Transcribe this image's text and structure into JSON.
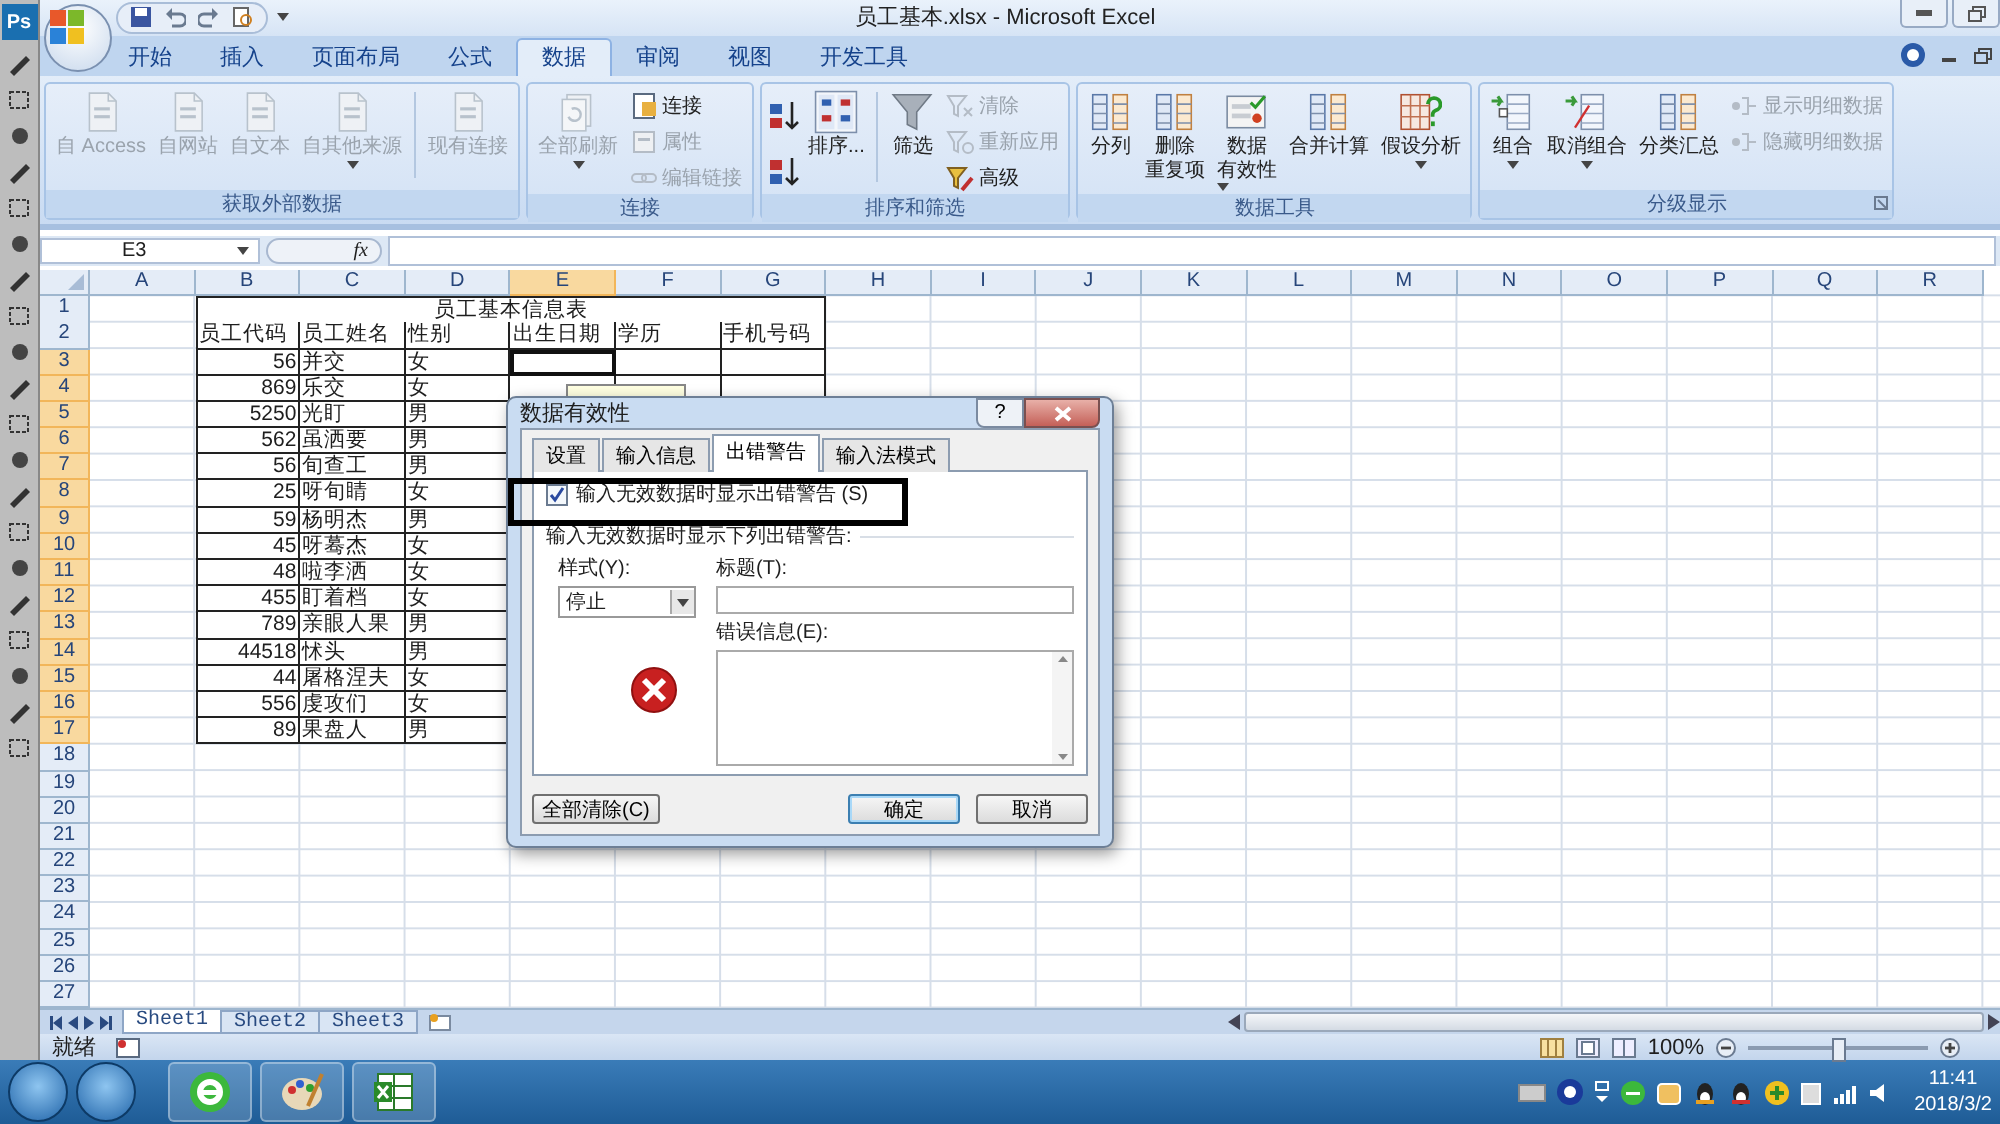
{
  "ps_label": "Ps",
  "window": {
    "title": "员工基本.xlsx - Microsoft Excel"
  },
  "ribbon_tabs": [
    {
      "label": "开始",
      "selected": false
    },
    {
      "label": "插入",
      "selected": false
    },
    {
      "label": "页面布局",
      "selected": false
    },
    {
      "label": "公式",
      "selected": false
    },
    {
      "label": "数据",
      "selected": true
    },
    {
      "label": "审阅",
      "selected": false
    },
    {
      "label": "视图",
      "selected": false
    },
    {
      "label": "开发工具",
      "selected": false
    }
  ],
  "ribbon_groups": [
    {
      "title": "获取外部数据",
      "launcher": false,
      "items": [
        {
          "kind": "large",
          "lines": [
            "自 Access"
          ],
          "disabled": true,
          "dropdown": false
        },
        {
          "kind": "large",
          "lines": [
            "自网站"
          ],
          "disabled": true,
          "dropdown": false
        },
        {
          "kind": "large",
          "lines": [
            "自文本"
          ],
          "disabled": true,
          "dropdown": false
        },
        {
          "kind": "large",
          "lines": [
            "自其他来源"
          ],
          "disabled": true,
          "dropdown": true
        },
        {
          "kind": "separator"
        },
        {
          "kind": "large",
          "lines": [
            "现有连接"
          ],
          "disabled": true,
          "dropdown": false
        }
      ]
    },
    {
      "title": "连接",
      "launcher": false,
      "items": [
        {
          "kind": "large",
          "lines": [
            "全部刷新"
          ],
          "disabled": true,
          "dropdown": true
        },
        {
          "kind": "stack",
          "items": [
            {
              "label": "连接",
              "disabled": false
            },
            {
              "label": "属性",
              "disabled": true
            },
            {
              "label": "编辑链接",
              "disabled": true
            }
          ]
        }
      ]
    },
    {
      "title": "排序和筛选",
      "launcher": false,
      "items": [
        {
          "kind": "sort_pair"
        },
        {
          "kind": "large",
          "lines": [
            "排序..."
          ],
          "disabled": false,
          "dropdown": false
        },
        {
          "kind": "separator"
        },
        {
          "kind": "large",
          "lines": [
            "筛选"
          ],
          "disabled": false,
          "dropdown": false
        },
        {
          "kind": "stack",
          "items": [
            {
              "label": "清除",
              "disabled": true
            },
            {
              "label": "重新应用",
              "disabled": true
            },
            {
              "label": "高级",
              "disabled": false
            }
          ]
        }
      ]
    },
    {
      "title": "数据工具",
      "launcher": false,
      "items": [
        {
          "kind": "large",
          "lines": [
            "分列"
          ],
          "disabled": false,
          "dropdown": false
        },
        {
          "kind": "large",
          "lines": [
            "删除",
            "重复项"
          ],
          "disabled": false,
          "dropdown": false
        },
        {
          "kind": "large",
          "lines": [
            "数据",
            "有效性"
          ],
          "disabled": false,
          "dropdown": true
        },
        {
          "kind": "large",
          "lines": [
            "合并计算"
          ],
          "disabled": false,
          "dropdown": false
        },
        {
          "kind": "large",
          "lines": [
            "假设分析"
          ],
          "disabled": false,
          "dropdown": true
        }
      ]
    },
    {
      "title": "分级显示",
      "launcher": true,
      "items": [
        {
          "kind": "large",
          "lines": [
            "组合"
          ],
          "disabled": false,
          "dropdown": true
        },
        {
          "kind": "large",
          "lines": [
            "取消组合"
          ],
          "disabled": false,
          "dropdown": true
        },
        {
          "kind": "large",
          "lines": [
            "分类汇总"
          ],
          "disabled": false,
          "dropdown": false
        },
        {
          "kind": "stack",
          "items": [
            {
              "label": "显示明细数据",
              "disabled": true
            },
            {
              "label": "隐藏明细数据",
              "disabled": true
            }
          ]
        }
      ]
    }
  ],
  "formula_bar": {
    "name_box": "E3",
    "fx": "fx"
  },
  "columns": [
    {
      "label": "A",
      "selected": false
    },
    {
      "label": "B",
      "selected": false
    },
    {
      "label": "C",
      "selected": false
    },
    {
      "label": "D",
      "selected": false
    },
    {
      "label": "E",
      "selected": true
    },
    {
      "label": "F",
      "selected": false
    },
    {
      "label": "G",
      "selected": false
    },
    {
      "label": "H",
      "selected": false
    },
    {
      "label": "I",
      "selected": false
    },
    {
      "label": "J",
      "selected": false
    },
    {
      "label": "K",
      "selected": false
    },
    {
      "label": "L",
      "selected": false
    },
    {
      "label": "M",
      "selected": false
    },
    {
      "label": "N",
      "selected": false
    },
    {
      "label": "O",
      "selected": false
    },
    {
      "label": "P",
      "selected": false
    },
    {
      "label": "Q",
      "selected": false
    },
    {
      "label": "R",
      "selected": false
    }
  ],
  "rows": [
    {
      "label": "1",
      "selected": false,
      "kind": "title",
      "text": "员工基本信息表"
    },
    {
      "label": "2",
      "selected": false,
      "kind": "header",
      "cells": [
        "员工代码",
        "员工姓名",
        "性别",
        "出生日期",
        "学历",
        "手机号码"
      ]
    },
    {
      "label": "3",
      "selected": true,
      "kind": "record",
      "active_cell": true,
      "code": "56",
      "name": "并交",
      "gender": "女"
    },
    {
      "label": "4",
      "selected": true,
      "kind": "record",
      "code": "869",
      "name": "乐交",
      "gender": "女"
    },
    {
      "label": "5",
      "selected": true,
      "kind": "record",
      "code": "5250",
      "name": "光盯",
      "gender": "男"
    },
    {
      "label": "6",
      "selected": true,
      "kind": "record",
      "code": "562",
      "name": "虽洒要",
      "gender": "男"
    },
    {
      "label": "7",
      "selected": true,
      "kind": "record",
      "code": "56",
      "name": "旬查工",
      "gender": "男"
    },
    {
      "label": "8",
      "selected": true,
      "kind": "record",
      "code": "25",
      "name": "呀旬睛",
      "gender": "女"
    },
    {
      "label": "9",
      "selected": true,
      "kind": "record",
      "code": "59",
      "name": "杨明杰",
      "gender": "男"
    },
    {
      "label": "10",
      "selected": true,
      "kind": "record",
      "code": "45",
      "name": "呀蓦杰",
      "gender": "女"
    },
    {
      "label": "11",
      "selected": true,
      "kind": "record",
      "code": "48",
      "name": "啦李洒",
      "gender": "女"
    },
    {
      "label": "12",
      "selected": true,
      "kind": "record",
      "code": "455",
      "name": "盯着档",
      "gender": "女"
    },
    {
      "label": "13",
      "selected": true,
      "kind": "record",
      "code": "789",
      "name": "亲眼人果",
      "gender": "男"
    },
    {
      "label": "14",
      "selected": true,
      "kind": "record",
      "code": "44518",
      "name": "怵头",
      "gender": "男"
    },
    {
      "label": "15",
      "selected": true,
      "kind": "record",
      "code": "44",
      "name": "屠格涅夫",
      "gender": "女"
    },
    {
      "label": "16",
      "selected": true,
      "kind": "record",
      "code": "556",
      "name": "虔攻们",
      "gender": "女"
    },
    {
      "label": "17",
      "selected": true,
      "kind": "record",
      "code": "89",
      "name": "果盘人",
      "gender": "男"
    },
    {
      "label": "18",
      "selected": false,
      "kind": "empty"
    },
    {
      "label": "19",
      "selected": false,
      "kind": "empty"
    },
    {
      "label": "20",
      "selected": false,
      "kind": "empty"
    },
    {
      "label": "21",
      "selected": false,
      "kind": "empty"
    },
    {
      "label": "22",
      "selected": false,
      "kind": "empty"
    },
    {
      "label": "23",
      "selected": false,
      "kind": "empty"
    },
    {
      "label": "24",
      "selected": false,
      "kind": "empty"
    },
    {
      "label": "25",
      "selected": false,
      "kind": "empty"
    },
    {
      "label": "26",
      "selected": false,
      "kind": "empty"
    },
    {
      "label": "27",
      "selected": false,
      "kind": "empty"
    }
  ],
  "sheet_tabs": [
    {
      "label": "Sheet1",
      "selected": true
    },
    {
      "label": "Sheet2",
      "selected": false
    },
    {
      "label": "Sheet3",
      "selected": false
    }
  ],
  "status_bar": {
    "text": "就绪",
    "zoom": "100%",
    "level": 0.5
  },
  "dialog": {
    "title": "数据有效性",
    "help": "?",
    "tabs": [
      {
        "label": "设置",
        "selected": false
      },
      {
        "label": "输入信息",
        "selected": false
      },
      {
        "label": "出错警告",
        "selected": true
      },
      {
        "label": "输入法模式",
        "selected": false
      }
    ],
    "checkbox": {
      "label": "输入无效数据时显示出错警告 (S)",
      "checked": true
    },
    "section_label": "输入无效数据时显示下列出错警告:",
    "style_label": "样式(Y):",
    "style_value": "停止",
    "title_label": "标题(T):",
    "message_label": "错误信息(E):",
    "buttons": [
      {
        "label": "全部清除(C)",
        "kind": "left"
      },
      {
        "label": "确定",
        "kind": "default"
      },
      {
        "label": "取消",
        "kind": "normal"
      }
    ]
  },
  "taskbar": {
    "time": "11:41",
    "date": "2018/3/2"
  }
}
